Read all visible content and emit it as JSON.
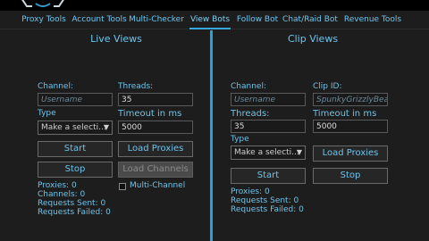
{
  "tabs": [
    "Proxy Tools",
    "Account Tools",
    "Multi-Checker",
    "View Bots",
    "Follow Bot",
    "Chat/Raid Bot",
    "Revenue Tools"
  ],
  "active_tab": "View Bots",
  "live": {
    "title": "Live Views",
    "channel_label": "Channel:",
    "channel_placeholder": "Username",
    "threads_label": "Threads:",
    "threads_value": "35",
    "type_label": "Type",
    "type_value": "Make a selecti...",
    "timeout_label": "Timeout in ms",
    "timeout_value": "5000",
    "start_label": "Start",
    "load_proxies_label": "Load Proxies",
    "stop_label": "Stop",
    "load_channels_label": "Load Channels",
    "multi_channel_label": "Multi-Channel",
    "multi_channel_checked": false,
    "stats": [
      "Proxies: 0",
      "Channels: 0",
      "Requests Sent: 0",
      "Requests Failed: 0"
    ]
  },
  "clip": {
    "title": "Clip Views",
    "channel_label": "Channel:",
    "channel_placeholder": "Username",
    "clip_id_label": "Clip ID:",
    "clip_id_placeholder": "SpunkyGrizzlyBear",
    "threads_label": "Threads:",
    "threads_value": "35",
    "timeout_label": "Timeout in ms",
    "timeout_value": "5000",
    "type_label": "Type",
    "type_value": "Make a selecti...",
    "load_proxies_label": "Load Proxies",
    "start_label": "Start",
    "stop_label": "Stop",
    "stats": [
      "Proxies: 0",
      "Requests Sent: 0",
      "Requests Failed: 0"
    ]
  },
  "colors": {
    "accent": "#2e9fd2",
    "text": "#6fc3e8",
    "bg": "#1d1d1d"
  }
}
